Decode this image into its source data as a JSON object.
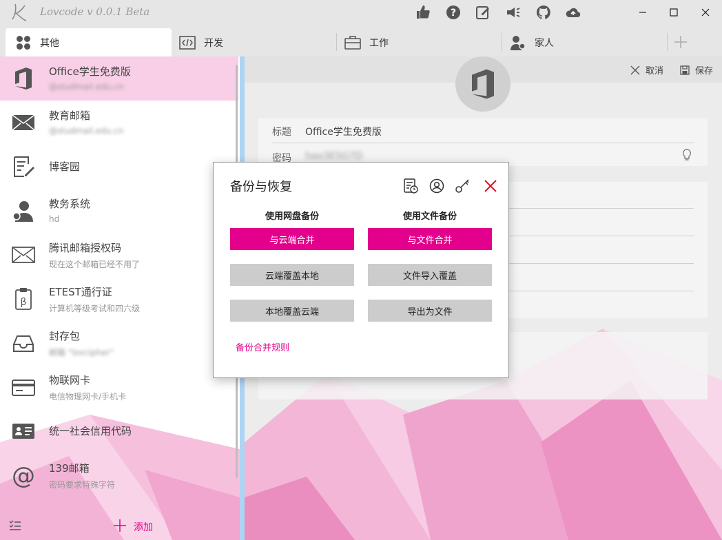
{
  "window": {
    "app_title": "Lovcode  v 0.0.1 Beta",
    "toolbar_icons": [
      "thumbs-up-icon",
      "help-icon",
      "edit-icon",
      "megaphone-icon",
      "github-icon",
      "cloud-sync-icon"
    ],
    "controls": [
      "minimize-icon",
      "maximize-icon",
      "close-icon"
    ]
  },
  "tabs": [
    {
      "label": "其他",
      "icon": "grid-icon",
      "active": true
    },
    {
      "label": "开发",
      "icon": "code-icon",
      "active": false
    },
    {
      "label": "工作",
      "icon": "briefcase-icon",
      "active": false
    },
    {
      "label": "家人",
      "icon": "people-icon",
      "active": false
    }
  ],
  "sidebar": {
    "items": [
      {
        "title": "Office学生免费版",
        "subtitle": "@studmail.edu.cn",
        "icon": "office-icon",
        "blurred": true
      },
      {
        "title": "教育邮箱",
        "subtitle": "@studmail.edu.cn",
        "icon": "mail-icon",
        "blurred": true
      },
      {
        "title": "博客园",
        "subtitle": "",
        "icon": "note-edit-icon",
        "blurred": false
      },
      {
        "title": "教务系统",
        "subtitle": "hd",
        "icon": "user-admin-icon",
        "blurred": false
      },
      {
        "title": "腾讯邮箱授权码",
        "subtitle": "现在这个邮箱已经不用了",
        "icon": "mail-outline-icon",
        "blurred": false
      },
      {
        "title": "ETEST通行证",
        "subtitle": "计算机等级考试和四六级",
        "icon": "clipboard-beta-icon",
        "blurred": false
      },
      {
        "title": "封存包",
        "subtitle": "邮箱 \"lovcipher\"",
        "icon": "inbox-tray-icon",
        "blurred": true
      },
      {
        "title": "物联网卡",
        "subtitle": "电信物理网卡/手机卡",
        "icon": "card-icon",
        "blurred": false
      },
      {
        "title": "统一社会信用代码",
        "subtitle": "",
        "icon": "id-card-icon",
        "blurred": false
      },
      {
        "title": "139邮箱",
        "subtitle": "密码要求特殊字符",
        "icon": "at-icon",
        "blurred": false
      }
    ],
    "add_label": "添加"
  },
  "detail": {
    "cancel_label": "取消",
    "save_label": "保存",
    "title_label": "标题",
    "title_value": "Office学生免费版",
    "password_label": "密码",
    "password_value": "hao3E5G7D"
  },
  "dialog": {
    "title": "备份与恢复",
    "col_cloud": "使用网盘备份",
    "col_file": "使用文件备份",
    "btn_cloud_merge": "与云端合并",
    "btn_file_merge": "与文件合并",
    "btn_cloud_overwrite_local": "云端覆盖本地",
    "btn_file_import_overwrite": "文件导入覆盖",
    "btn_local_overwrite_cloud": "本地覆盖云端",
    "btn_export_file": "导出为文件",
    "rule_link": "备份合并规则"
  },
  "colors": {
    "accent": "#e3008c",
    "selected_bg": "#f8cfe6",
    "divider": "#aed4f4"
  }
}
